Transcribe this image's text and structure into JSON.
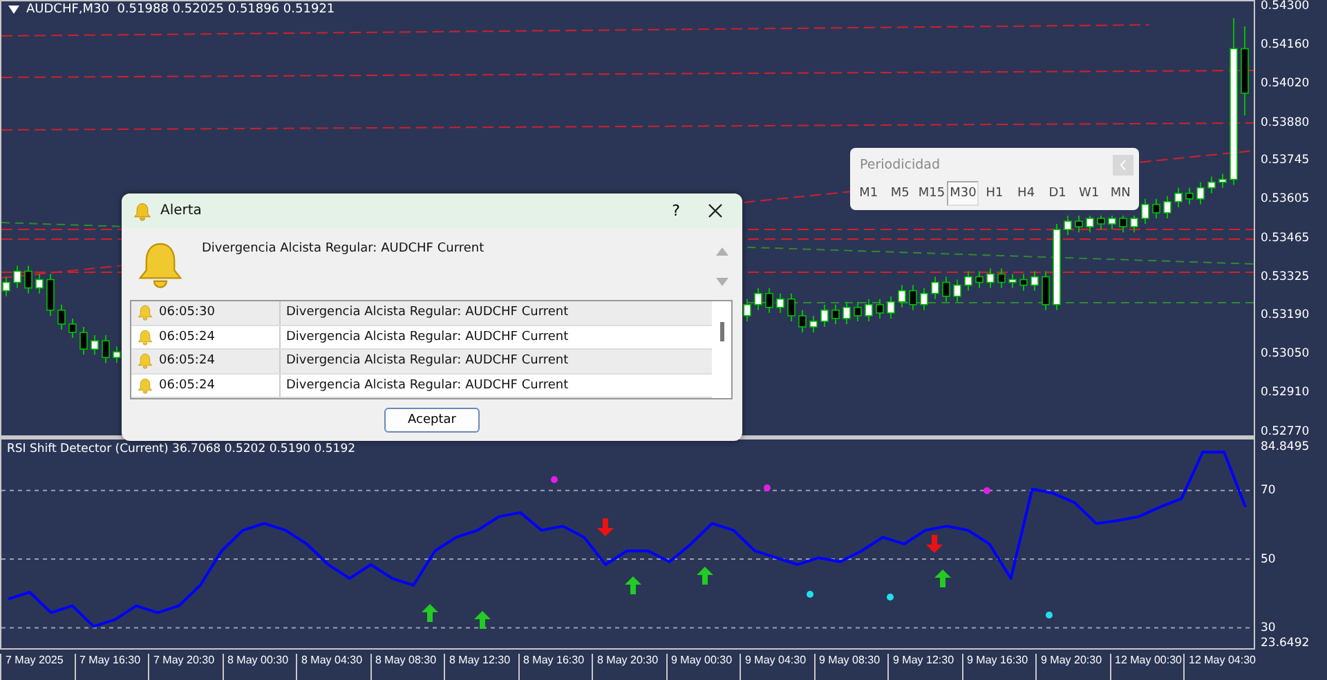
{
  "chart": {
    "title": "AUDCHF,M30  0.51988 0.52025 0.51896 0.51921",
    "chart_data": {
      "type": "candlestick",
      "ylim": [
        0.5275,
        0.5431
      ],
      "yticks": [
        {
          "value": 0.543,
          "label": "0.54300"
        },
        {
          "value": 0.5416,
          "label": "0.54160"
        },
        {
          "value": 0.5402,
          "label": "0.54020"
        },
        {
          "value": 0.5388,
          "label": "0.53880"
        },
        {
          "value": 0.53745,
          "label": "0.53745"
        },
        {
          "value": 0.53605,
          "label": "0.53605"
        },
        {
          "value": 0.53465,
          "label": "0.53465"
        },
        {
          "value": 0.53325,
          "label": "0.53325"
        },
        {
          "value": 0.5319,
          "label": "0.53190"
        },
        {
          "value": 0.5305,
          "label": "0.53050"
        },
        {
          "value": 0.5291,
          "label": "0.52910"
        },
        {
          "value": 0.5277,
          "label": "0.52770"
        }
      ],
      "ohlc": [
        [
          0.5327,
          0.5332,
          0.5325,
          0.533
        ],
        [
          0.533,
          0.5336,
          0.5328,
          0.5334
        ],
        [
          0.5334,
          0.5336,
          0.5326,
          0.5328
        ],
        [
          0.5328,
          0.5333,
          0.5326,
          0.5331
        ],
        [
          0.5331,
          0.5333,
          0.5318,
          0.532
        ],
        [
          0.532,
          0.5322,
          0.5313,
          0.5315
        ],
        [
          0.5315,
          0.5317,
          0.531,
          0.5312
        ],
        [
          0.5312,
          0.5314,
          0.5304,
          0.5306
        ],
        [
          0.5306,
          0.5311,
          0.5304,
          0.5309
        ],
        [
          0.5309,
          0.5311,
          0.5301,
          0.5303
        ],
        [
          0.5303,
          0.5307,
          0.5301,
          0.5305
        ],
        null,
        null,
        null,
        null,
        null,
        null,
        null,
        null,
        null,
        null,
        null,
        null,
        null,
        null,
        null,
        null,
        null,
        null,
        null,
        null,
        null,
        null,
        null,
        null,
        null,
        null,
        null,
        null,
        null,
        null,
        null,
        null,
        null,
        null,
        null,
        null,
        null,
        null,
        null,
        null,
        null,
        null,
        null,
        null,
        null,
        null,
        null,
        null,
        null,
        null,
        null,
        null,
        null,
        null,
        null,
        null,
        [
          0.5318,
          0.5324,
          0.5316,
          0.5322
        ],
        [
          0.5322,
          0.5328,
          0.532,
          0.5326
        ],
        [
          0.5326,
          0.5328,
          0.5319,
          0.5321
        ],
        [
          0.5321,
          0.5326,
          0.5319,
          0.5324
        ],
        [
          0.5324,
          0.5326,
          0.5316,
          0.5318
        ],
        [
          0.5318,
          0.532,
          0.5312,
          0.5314
        ],
        [
          0.5314,
          0.5318,
          0.5312,
          0.5316
        ],
        [
          0.5316,
          0.5322,
          0.5314,
          0.532
        ],
        [
          0.532,
          0.5322,
          0.5315,
          0.5317
        ],
        [
          0.5317,
          0.5323,
          0.5315,
          0.5321
        ],
        [
          0.5321,
          0.5323,
          0.5316,
          0.5318
        ],
        [
          0.5318,
          0.5324,
          0.5316,
          0.5322
        ],
        [
          0.5322,
          0.5324,
          0.5317,
          0.5319
        ],
        [
          0.5319,
          0.5325,
          0.5317,
          0.5323
        ],
        [
          0.5323,
          0.5329,
          0.5321,
          0.5327
        ],
        [
          0.5327,
          0.5329,
          0.532,
          0.5322
        ],
        [
          0.5322,
          0.5328,
          0.532,
          0.5326
        ],
        [
          0.5326,
          0.5332,
          0.5324,
          0.533
        ],
        [
          0.533,
          0.5332,
          0.5323,
          0.5325
        ],
        [
          0.5325,
          0.5331,
          0.5323,
          0.5329
        ],
        [
          0.5329,
          0.5334,
          0.5327,
          0.5332
        ],
        [
          0.5332,
          0.5334,
          0.5328,
          0.533
        ],
        [
          0.533,
          0.5335,
          0.5328,
          0.5333
        ],
        [
          0.5333,
          0.5335,
          0.5328,
          0.533
        ],
        [
          0.533,
          0.5333,
          0.5328,
          0.5331
        ],
        [
          0.5331,
          0.5333,
          0.5327,
          0.5329
        ],
        [
          0.5329,
          0.5334,
          0.5327,
          0.5332
        ],
        [
          0.5332,
          0.5334,
          0.532,
          0.5322
        ],
        [
          0.5322,
          0.5351,
          0.532,
          0.5349
        ],
        [
          0.5349,
          0.5354,
          0.5347,
          0.5352
        ],
        [
          0.5352,
          0.5354,
          0.5348,
          0.535
        ],
        [
          0.535,
          0.5354,
          0.5348,
          0.5353
        ],
        [
          0.5353,
          0.5354,
          0.5349,
          0.5351
        ],
        [
          0.5351,
          0.5354,
          0.5349,
          0.5353
        ],
        [
          0.5353,
          0.5354,
          0.5348,
          0.535
        ],
        [
          0.535,
          0.5354,
          0.5348,
          0.5353
        ],
        [
          0.5353,
          0.536,
          0.5351,
          0.5358
        ],
        [
          0.5358,
          0.536,
          0.5353,
          0.5355
        ],
        [
          0.5355,
          0.5361,
          0.5353,
          0.5359
        ],
        [
          0.5359,
          0.5364,
          0.5357,
          0.5362
        ],
        [
          0.5362,
          0.5364,
          0.5358,
          0.536
        ],
        [
          0.536,
          0.5366,
          0.5358,
          0.5364
        ],
        [
          0.5364,
          0.5368,
          0.5362,
          0.5366
        ],
        [
          0.5366,
          0.5369,
          0.5364,
          0.5367
        ],
        [
          0.5367,
          0.5425,
          0.5365,
          0.5414
        ],
        [
          0.5414,
          0.5422,
          0.539,
          0.5398
        ]
      ]
    }
  },
  "periodicity": {
    "title": "Periodicidad",
    "timeframes": [
      {
        "label": "M1",
        "selected": false
      },
      {
        "label": "M5",
        "selected": false
      },
      {
        "label": "M15",
        "selected": false
      },
      {
        "label": "M30",
        "selected": true
      },
      {
        "label": "H1",
        "selected": false
      },
      {
        "label": "H4",
        "selected": false
      },
      {
        "label": "D1",
        "selected": false
      },
      {
        "label": "W1",
        "selected": false
      },
      {
        "label": "MN",
        "selected": false
      }
    ]
  },
  "indicator": {
    "title": "RSI Shift Detector (Current) 36.7068 0.5202 0.5190 0.5192",
    "chart_data": {
      "type": "line",
      "grid": true,
      "ylim": [
        23.6492,
        84.8495
      ],
      "yticks": [
        {
          "value": 84.8495,
          "label": "84.8495"
        },
        {
          "value": 70,
          "label": "70"
        },
        {
          "value": 50,
          "label": "50"
        },
        {
          "value": 30,
          "label": "30"
        },
        {
          "value": 23.6492,
          "label": "23.6492"
        }
      ],
      "series": [
        {
          "color": "#0000ff",
          "values": [
            38.4,
            40.4,
            34.4,
            36.4,
            30.4,
            32.4,
            36.4,
            34.4,
            36.4,
            42.4,
            52.4,
            58.4,
            60.4,
            58.4,
            54.4,
            48.4,
            44.4,
            48.4,
            44.4,
            42.4,
            52.4,
            56.4,
            58.4,
            62.4,
            63.6,
            58.4,
            59.6,
            56.4,
            48.4,
            52.4,
            52.4,
            49.2,
            54.4,
            60.4,
            58.4,
            52.4,
            50.4,
            48.4,
            50.4,
            49.2,
            52.4,
            56.4,
            54.4,
            58.4,
            59.6,
            58.4,
            54.4,
            44.4,
            70.4,
            69.2,
            66.4,
            60.4,
            61.2,
            62.4,
            65.2,
            67.6,
            81.2,
            81.2,
            65.2
          ]
        }
      ]
    }
  },
  "time_axis": [
    "7 May 2025",
    "7 May 16:30",
    "7 May 20:30",
    "8 May 00:30",
    "8 May 04:30",
    "8 May 08:30",
    "8 May 12:30",
    "8 May 16:30",
    "8 May 20:30",
    "9 May 00:30",
    "9 May 04:30",
    "9 May 08:30",
    "9 May 12:30",
    "9 May 16:30",
    "9 May 20:30",
    "12 May 00:30",
    "12 May 04:30"
  ],
  "alert_dialog": {
    "title": "Alerta",
    "help": "?",
    "message": "Divergencia Alcista Regular: AUDCHF Current",
    "rows": [
      {
        "time": "06:05:30",
        "message": "Divergencia Alcista Regular: AUDCHF Current"
      },
      {
        "time": "06:05:24",
        "message": "Divergencia Alcista Regular: AUDCHF Current"
      },
      {
        "time": "06:05:24",
        "message": "Divergencia Alcista Regular: AUDCHF Current"
      },
      {
        "time": "06:05:24",
        "message": "Divergencia Alcista Regular: AUDCHF Current"
      }
    ],
    "button": "Aceptar"
  }
}
